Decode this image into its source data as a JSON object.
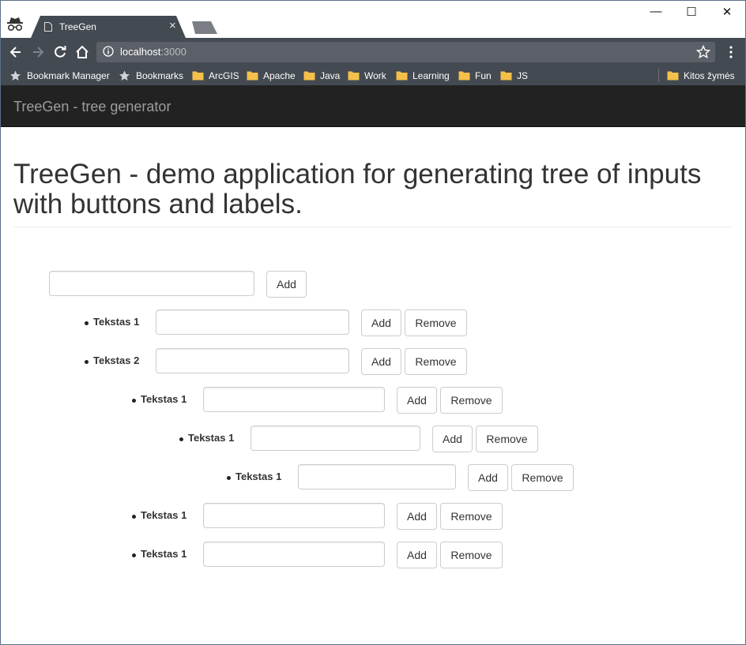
{
  "browser": {
    "tab_title": "TreeGen",
    "tab_close": "×",
    "url_host": "localhost",
    "url_port": ":3000",
    "window_controls": {
      "minimize": "—",
      "maximize": "☐",
      "close": "✕"
    },
    "bookmarks": [
      {
        "label": "Bookmark Manager",
        "icon": "star-icon"
      },
      {
        "label": "Bookmarks",
        "icon": "star-icon"
      },
      {
        "label": "ArcGIS",
        "icon": "folder-icon"
      },
      {
        "label": "Apache",
        "icon": "folder-icon"
      },
      {
        "label": "Java",
        "icon": "folder-icon"
      },
      {
        "label": "Work",
        "icon": "folder-icon"
      },
      {
        "label": "Learning",
        "icon": "folder-icon"
      },
      {
        "label": "Fun",
        "icon": "folder-icon"
      },
      {
        "label": "JS",
        "icon": "folder-icon"
      }
    ],
    "other_bookmarks": {
      "label": "Kitos žymės",
      "icon": "folder-icon"
    }
  },
  "app": {
    "brand": "TreeGen - tree generator",
    "heading_line1": "TreeGen - demo application for generating tree of inputs",
    "heading_line2": "with buttons and labels."
  },
  "tree": {
    "root": {
      "input_value": "",
      "add_label": "Add"
    },
    "nodes": [
      {
        "label": "Tekstas 1",
        "depth": 1,
        "input_value": "",
        "add_label": "Add",
        "remove_label": "Remove"
      },
      {
        "label": "Tekstas 2",
        "depth": 1,
        "input_value": "",
        "add_label": "Add",
        "remove_label": "Remove"
      },
      {
        "label": "Tekstas 1",
        "depth": 2,
        "input_value": "",
        "add_label": "Add",
        "remove_label": "Remove"
      },
      {
        "label": "Tekstas 1",
        "depth": 3,
        "input_value": "",
        "add_label": "Add",
        "remove_label": "Remove"
      },
      {
        "label": "Tekstas 1",
        "depth": 4,
        "input_value": "",
        "add_label": "Add",
        "remove_label": "Remove"
      },
      {
        "label": "Tekstas 1",
        "depth": 2,
        "input_value": "",
        "add_label": "Add",
        "remove_label": "Remove"
      },
      {
        "label": "Tekstas 1",
        "depth": 2,
        "input_value": "",
        "add_label": "Add",
        "remove_label": "Remove"
      }
    ]
  },
  "colors": {
    "chrome_dark": "#444a52",
    "navbar": "#222222",
    "brand_text": "#9d9d9d",
    "text": "#333333"
  }
}
